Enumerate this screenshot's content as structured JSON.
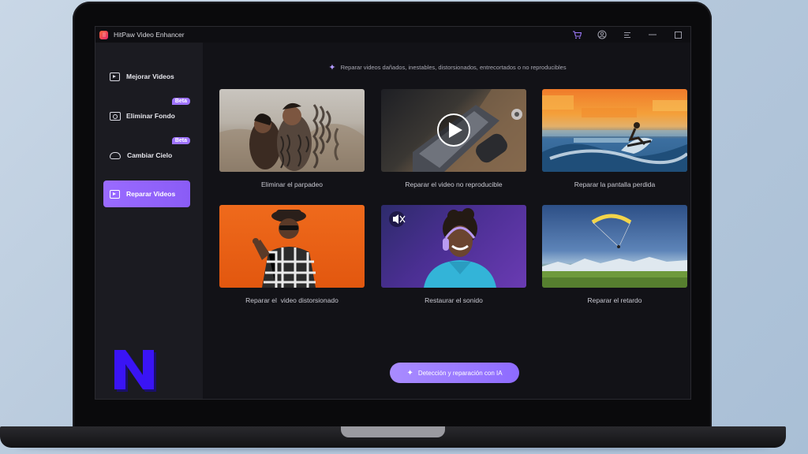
{
  "app": {
    "title": "HitPaw Video Enhancer"
  },
  "titlebar": {
    "icons": [
      "cart-icon",
      "account-icon",
      "menu-icon",
      "minimize-icon",
      "maximize-icon"
    ],
    "glyphs": {
      "cart": "🛒",
      "account": "◯",
      "menu": "≡",
      "minimize": "—",
      "maximize": "☐"
    }
  },
  "sidebar": {
    "items": [
      {
        "label": "Mejorar Videos",
        "icon": "video-enhance-icon",
        "active": false
      },
      {
        "label": "Eliminar Fondo",
        "icon": "remove-background-icon",
        "active": false,
        "badge": "Beta"
      },
      {
        "label": "Cambiar Cielo",
        "icon": "sky-replace-icon",
        "active": false,
        "badge": "Beta"
      },
      {
        "label": "Reparar Videos",
        "icon": "video-repair-icon",
        "active": true
      }
    ]
  },
  "main": {
    "headline": "Reparar videos dañados, inestables, distorsionados, entrecortados o no reproducibles",
    "cards": [
      {
        "label": "Eliminar el parpadeo"
      },
      {
        "label": "Reparar el video no reproducible"
      },
      {
        "label": "Reparar la pantalla perdida"
      },
      {
        "label": "Reparar el  video distorsionado"
      },
      {
        "label": "Restaurar el sonido"
      },
      {
        "label": "Reparar el retardo"
      }
    ],
    "ai_button": "Detección y reparación con IA"
  },
  "colors": {
    "accent": "#8e6bff",
    "sidebar_bg": "#1b1b21",
    "main_bg": "#121217"
  }
}
